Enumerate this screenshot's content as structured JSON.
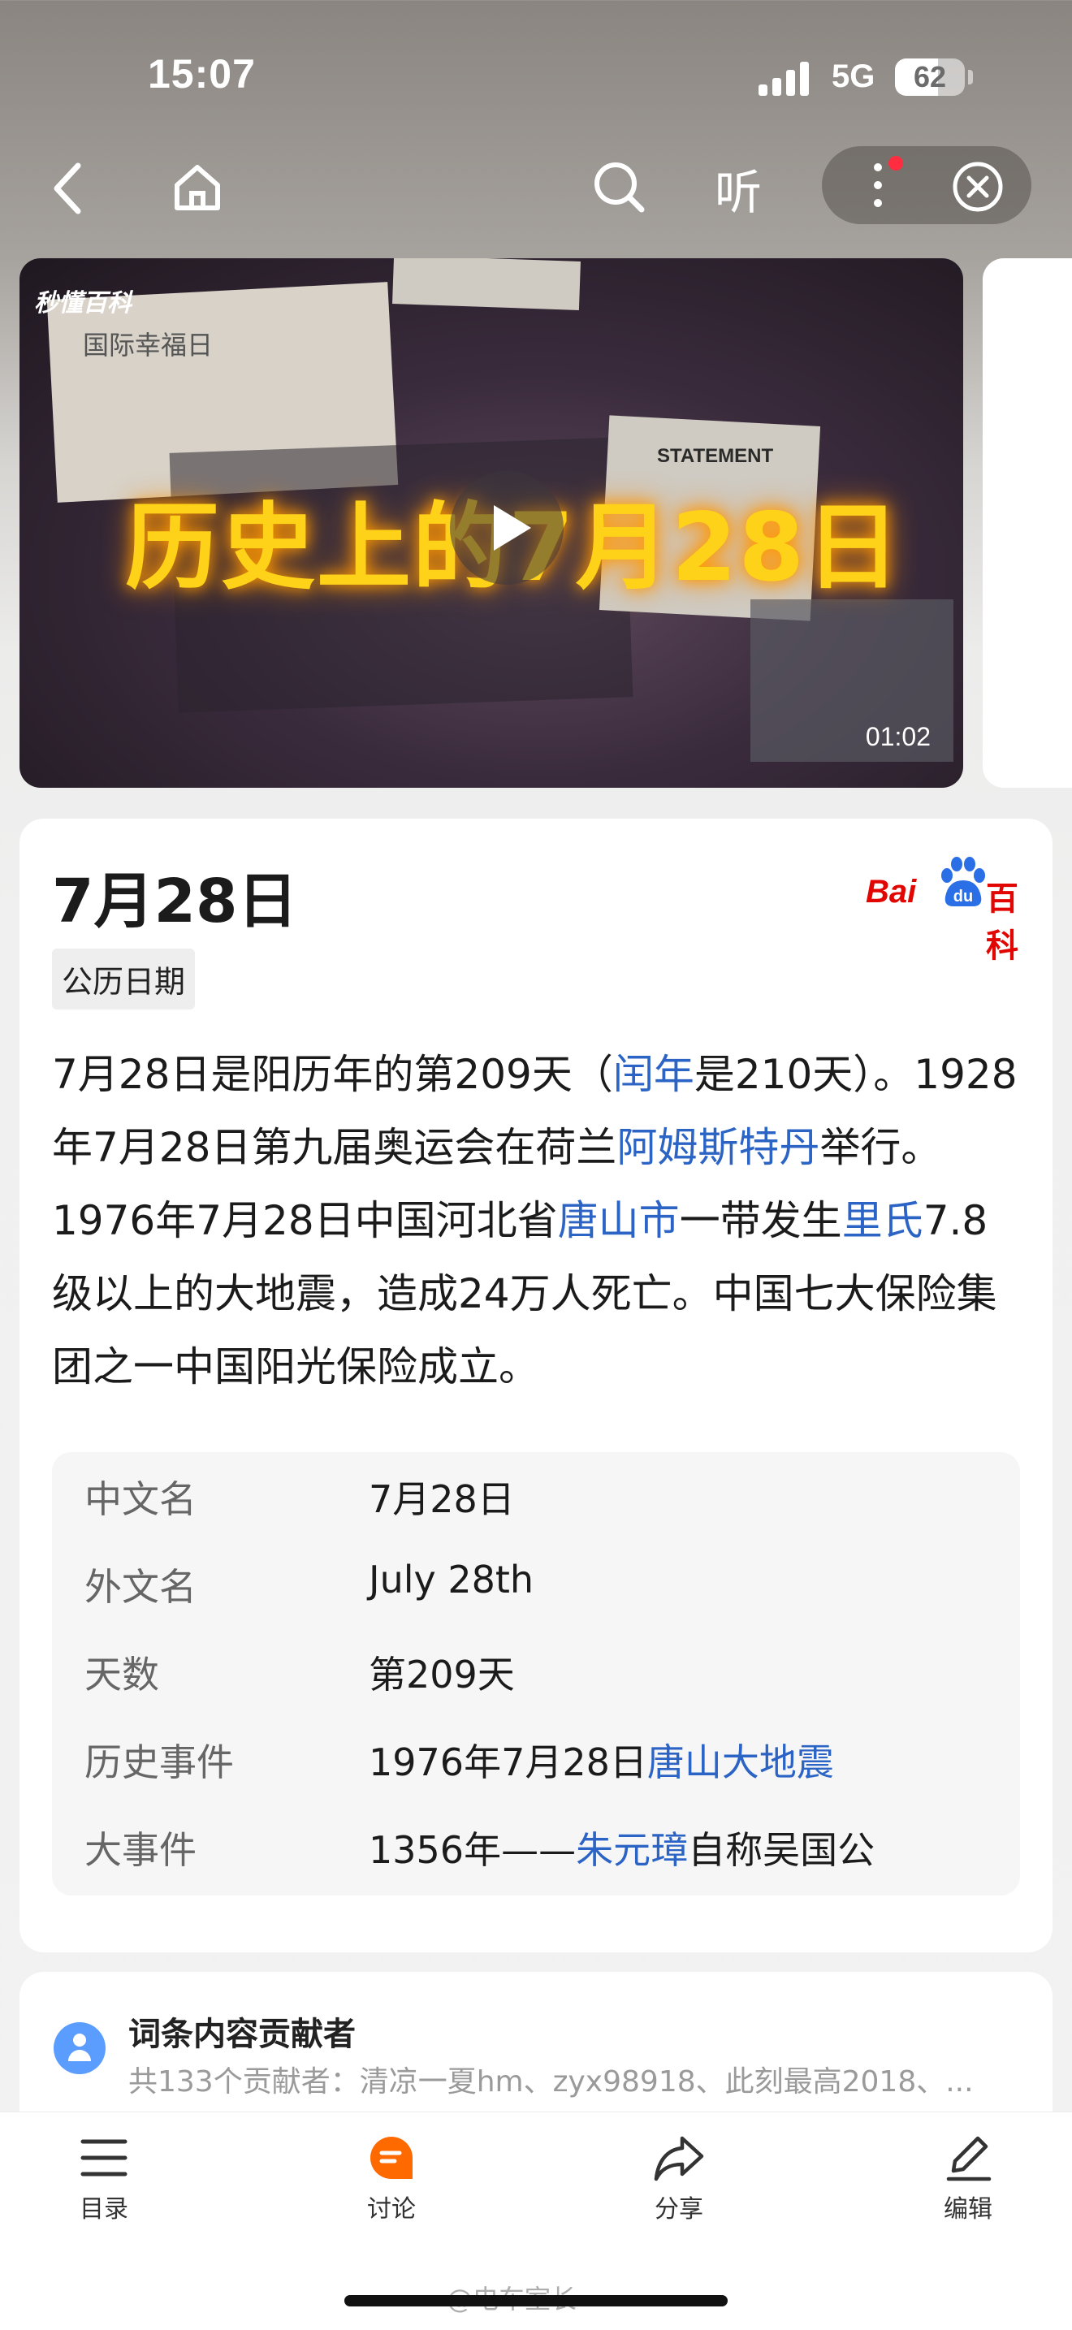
{
  "status_bar": {
    "time": "15:07",
    "network": "5G",
    "battery": "62",
    "battery_level": 0.62
  },
  "nav": {
    "listen_label": "听",
    "icons": [
      "back-icon",
      "home-icon",
      "search-icon",
      "more-icon",
      "close-icon"
    ]
  },
  "video": {
    "logo": "秒懂百科",
    "title": "历史上的7月28日",
    "duration": "01:02",
    "paper_heading": "国际幸福日",
    "statement": "STATEMENT"
  },
  "entry": {
    "title": "7月28日",
    "source_logo": {
      "bai": "Bai",
      "du": "du",
      "bk": "百科"
    },
    "tag": "公历日期",
    "intro": [
      {
        "t": "7月28日是阳历年的第209天（"
      },
      {
        "t": "闰年",
        "link": true
      },
      {
        "t": "是210天）。1928年7月28日第九届奥运会在荷兰"
      },
      {
        "t": "阿姆斯特丹",
        "link": true
      },
      {
        "t": "举行。1976年7月28日中国河北省"
      },
      {
        "t": "唐山市",
        "link": true
      },
      {
        "t": "一带发生"
      },
      {
        "t": "里氏",
        "link": true
      },
      {
        "t": "7.8级以上的大地震，造成24万人死亡。中国七大保险集团之一中国阳光保险成立。"
      }
    ],
    "info": [
      {
        "key": "中文名",
        "value": [
          {
            "t": "7月28日"
          }
        ]
      },
      {
        "key": "外文名",
        "value": [
          {
            "t": "July 28th"
          }
        ]
      },
      {
        "key": "天数",
        "value": [
          {
            "t": "第209天"
          }
        ]
      },
      {
        "key": "历史事件",
        "value": [
          {
            "t": "1976年7月28日"
          },
          {
            "t": "唐山大地震",
            "link": true
          }
        ]
      },
      {
        "key": "大事件",
        "value": [
          {
            "t": "1356年——"
          },
          {
            "t": "朱元璋",
            "link": true
          },
          {
            "t": "自称吴国公"
          }
        ]
      }
    ]
  },
  "contributors": {
    "title": "词条内容贡献者",
    "summary": "共133个贡献者：清凉一夏hm、zyx98918、此刻最高2018、..."
  },
  "tabbar": {
    "items": [
      {
        "label": "目录",
        "icon": "list-icon"
      },
      {
        "label": "讨论",
        "icon": "discuss-icon"
      },
      {
        "label": "分享",
        "icon": "share-icon"
      },
      {
        "label": "编辑",
        "icon": "edit-icon"
      }
    ]
  },
  "watermark": "@电车室长",
  "colors": {
    "link": "#2b64c5",
    "brand_red": "#e10601",
    "accent_orange": "#ff6a00",
    "video_title": "#ffd21a"
  }
}
